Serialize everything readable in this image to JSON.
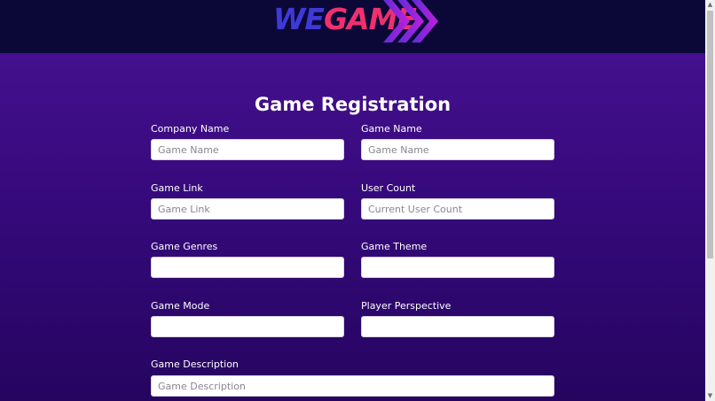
{
  "brand": {
    "logo_part1": "WE",
    "logo_part2": "GAME",
    "colors": {
      "we": "#3e3ad6",
      "game": "#f0306e",
      "arrows": "#a020e8"
    }
  },
  "form": {
    "title": "Game Registration",
    "fields": {
      "company_name": {
        "label": "Company Name",
        "placeholder": "Game Name",
        "value": ""
      },
      "game_name": {
        "label": "Game Name",
        "placeholder": "Game Name",
        "value": ""
      },
      "game_link": {
        "label": "Game Link",
        "placeholder": "Game Link",
        "value": ""
      },
      "user_count": {
        "label": "User Count",
        "placeholder": "Current User Count",
        "value": ""
      },
      "game_genres": {
        "label": "Game Genres",
        "placeholder": "",
        "value": ""
      },
      "game_theme": {
        "label": "Game Theme",
        "placeholder": "",
        "value": ""
      },
      "game_mode": {
        "label": "Game Mode",
        "placeholder": "",
        "value": ""
      },
      "player_perspective": {
        "label": "Player Perspective",
        "placeholder": "",
        "value": ""
      },
      "game_description": {
        "label": "Game Description",
        "placeholder": "Game Description",
        "value": ""
      }
    }
  },
  "scrollbar": {
    "up_icon": "▲",
    "down_icon": "▼"
  }
}
